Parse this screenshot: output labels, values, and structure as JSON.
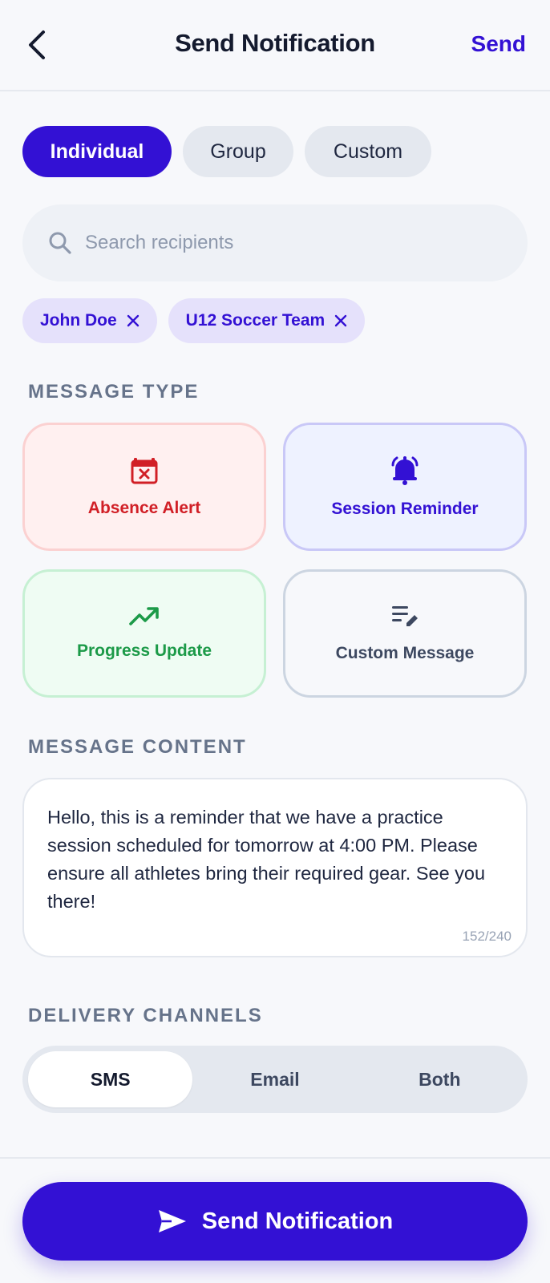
{
  "header": {
    "title": "Send Notification",
    "send_label": "Send",
    "back_icon": "chevron-left-icon"
  },
  "recipient_tabs": [
    {
      "label": "Individual",
      "active": true
    },
    {
      "label": "Group",
      "active": false
    },
    {
      "label": "Custom",
      "active": false
    }
  ],
  "search": {
    "placeholder": "Search recipients",
    "value": "",
    "icon": "search-icon"
  },
  "selected_recipients": [
    {
      "label": "John Doe"
    },
    {
      "label": "U12 Soccer Team"
    }
  ],
  "message_type": {
    "section_label": "MESSAGE TYPE",
    "options": [
      {
        "label": "Absence Alert",
        "icon": "calendar-x-icon",
        "color": "#d11f26"
      },
      {
        "label": "Session Reminder",
        "icon": "bell-icon",
        "color": "#3311d4"
      },
      {
        "label": "Progress Update",
        "icon": "trending-up-icon",
        "color": "#1c9a48"
      },
      {
        "label": "Custom Message",
        "icon": "edit-note-icon",
        "color": "#3d4860"
      }
    ]
  },
  "message_content": {
    "section_label": "MESSAGE CONTENT",
    "text": "Hello, this is a reminder that we have a practice session scheduled for tomorrow at 4:00 PM. Please ensure all athletes bring their required gear. See you there!",
    "counter": "152/240"
  },
  "delivery_channels": {
    "section_label": "DELIVERY CHANNELS",
    "options": [
      {
        "label": "SMS",
        "active": true
      },
      {
        "label": "Email",
        "active": false
      },
      {
        "label": "Both",
        "active": false
      }
    ]
  },
  "footer": {
    "send_button_label": "Send Notification",
    "send_icon": "send-icon"
  },
  "colors": {
    "primary": "#3311d4",
    "background": "#f7f8fb"
  }
}
